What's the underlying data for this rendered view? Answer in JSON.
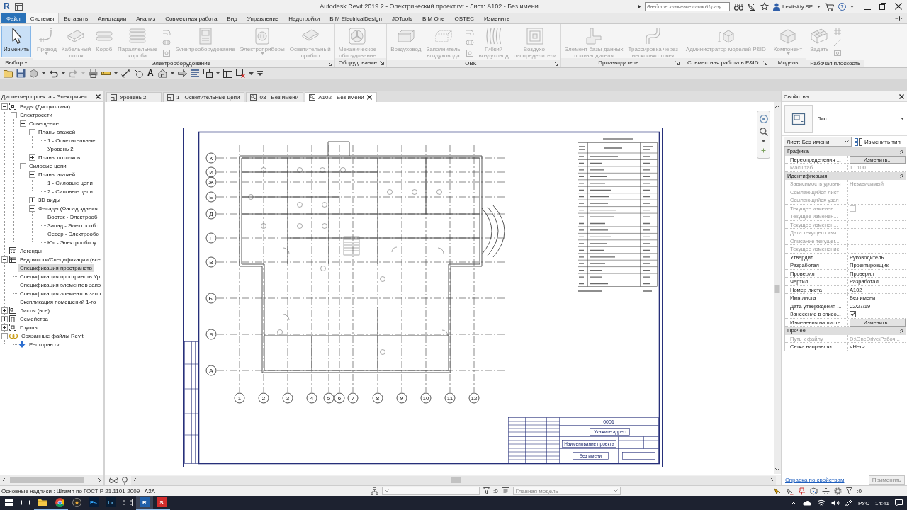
{
  "title_bar": {
    "logo": "R",
    "title": "Autodesk Revit 2019.2 - Электрический проект.rvt - Лист: A102 - Без имени",
    "search": {
      "placeholder": "Введите ключевое слово/фразу"
    },
    "user": "Levitskiy.SP",
    "help": "?"
  },
  "ribbon_tabs": [
    {
      "label": "Файл",
      "kind": "application",
      "selected": false
    },
    {
      "label": "Системы",
      "kind": "tab",
      "selected": true
    },
    {
      "label": "Вставить",
      "kind": "tab",
      "selected": false
    },
    {
      "label": "Аннотации",
      "kind": "tab",
      "selected": false
    },
    {
      "label": "Анализ",
      "kind": "tab",
      "selected": false
    },
    {
      "label": "Совместная работа",
      "kind": "tab",
      "selected": false
    },
    {
      "label": "Вид",
      "kind": "tab",
      "selected": false
    },
    {
      "label": "Управление",
      "kind": "tab",
      "selected": false
    },
    {
      "label": "Надстройки",
      "kind": "tab",
      "selected": false
    },
    {
      "label": "BIM ElectricalDesign",
      "kind": "tab",
      "selected": false
    },
    {
      "label": "JOTools",
      "kind": "tab",
      "selected": false
    },
    {
      "label": "BIM One",
      "kind": "tab",
      "selected": false
    },
    {
      "label": "OSTEC",
      "kind": "tab",
      "selected": false
    },
    {
      "label": "Изменить",
      "kind": "tab",
      "selected": false
    }
  ],
  "ribbon_groups": [
    {
      "label": "Выбор",
      "dropdown": true,
      "launcher": false,
      "buttons": [
        {
          "kind": "large",
          "label": "Изменить",
          "selected": true,
          "disabled": false
        }
      ]
    },
    {
      "label": "Электрооборудование",
      "launcher": true,
      "buttons": [
        {
          "kind": "large",
          "label": "Провод",
          "dropdown": true,
          "selected": false,
          "disabled": true
        },
        {
          "kind": "large",
          "label": "Кабельный\nлоток",
          "selected": false,
          "disabled": true
        },
        {
          "kind": "large",
          "label": "Короб",
          "selected": false,
          "disabled": true
        },
        {
          "kind": "large",
          "label": "Параллельные\nкороба",
          "selected": false,
          "disabled": true
        },
        {
          "kind": "stack",
          "disabled": true
        },
        {
          "kind": "large",
          "label": "Электрооборудование",
          "selected": false,
          "disabled": true
        },
        {
          "kind": "large",
          "label": "Электроприборы",
          "dropdown": true,
          "selected": false,
          "disabled": true
        },
        {
          "kind": "large",
          "label": "Осветительный\nприбор",
          "selected": false,
          "disabled": true
        }
      ]
    },
    {
      "label": "Оборудование",
      "launcher": true,
      "buttons": [
        {
          "kind": "large",
          "label": "Механическое\nоборудование",
          "selected": false,
          "disabled": true
        }
      ]
    },
    {
      "label": "ОВК",
      "launcher": true,
      "buttons": [
        {
          "kind": "large",
          "label": "Воздуховод",
          "selected": false,
          "disabled": true
        },
        {
          "kind": "large",
          "label": "Заполнитель\nвоздуховода",
          "selected": false,
          "disabled": true
        },
        {
          "kind": "stack",
          "disabled": true
        },
        {
          "kind": "large",
          "label": "Гибкий\nвоздуховод",
          "selected": false,
          "disabled": true
        },
        {
          "kind": "large",
          "label": "Воздухо-\nраспределители",
          "selected": false,
          "disabled": true
        }
      ]
    },
    {
      "label": "Производитель",
      "launcher": true,
      "buttons": [
        {
          "kind": "large",
          "label": "Элемент базы данных\nпроизводителя",
          "selected": false,
          "disabled": true
        },
        {
          "kind": "large",
          "label": "Трассировка через\nнесколько точек",
          "selected": false,
          "disabled": true
        }
      ]
    },
    {
      "label": "Совместная работа в P&ID",
      "launcher": true,
      "buttons": [
        {
          "kind": "large",
          "label": "Администратор моделей P&ID",
          "selected": false,
          "disabled": true
        }
      ]
    },
    {
      "label": "Модель",
      "launcher": false,
      "buttons": [
        {
          "kind": "large",
          "label": "Компонент",
          "dropdown": true,
          "selected": false,
          "disabled": true
        }
      ]
    },
    {
      "label": "Рабочая плоскость",
      "launcher": false,
      "buttons": [
        {
          "kind": "large",
          "label": "Задать",
          "selected": false,
          "disabled": true
        },
        {
          "kind": "stack",
          "disabled": true
        }
      ]
    }
  ],
  "quick_access": [
    {
      "kind": "open",
      "disabled": false
    },
    {
      "kind": "save",
      "disabled": false
    },
    {
      "kind": "sync",
      "dropdown": true,
      "disabled": false
    },
    {
      "kind": "undo",
      "dropdown": true,
      "disabled": false
    },
    {
      "kind": "redo",
      "dropdown": true,
      "disabled": true
    },
    {
      "kind": "print",
      "disabled": false
    },
    {
      "kind": "measure",
      "dropdown": true,
      "disabled": false
    },
    {
      "kind": "dimension",
      "disabled": false
    },
    {
      "kind": "tag",
      "disabled": false
    },
    {
      "kind": "text",
      "label": "A",
      "disabled": false
    },
    {
      "kind": "view3d",
      "dropdown": true,
      "disabled": false
    },
    {
      "kind": "section",
      "disabled": false
    },
    {
      "kind": "thinlines",
      "disabled": false
    },
    {
      "kind": "switchwindows",
      "dropdown": true,
      "disabled": false
    },
    {
      "kind": "tilewindows",
      "disabled": false
    },
    {
      "kind": "closewindows",
      "disabled": false
    },
    {
      "kind": "more",
      "disabled": false
    },
    {
      "kind": "customize",
      "disabled": false
    }
  ],
  "project_browser": {
    "title": "Диспетчер проекта - Электричес...",
    "tree": [
      {
        "label": "Виды (Дисциплина)",
        "kind": "views",
        "selected": false,
        "expanded": true,
        "children": [
          {
            "label": "Электросети",
            "selected": false,
            "expanded": true,
            "children": [
              {
                "label": "Освещение",
                "selected": false,
                "expanded": true,
                "children": [
                  {
                    "label": "Планы этажей",
                    "selected": false,
                    "expanded": true,
                    "children": [
                      {
                        "label": "1 - Осветительные",
                        "selected": false
                      },
                      {
                        "label": "Уровень 2",
                        "selected": false
                      }
                    ]
                  },
                  {
                    "label": "Планы потолков",
                    "selected": false,
                    "expanded": false
                  }
                ]
              },
              {
                "label": "Силовые цепи",
                "selected": false,
                "expanded": true,
                "children": [
                  {
                    "label": "Планы этажей",
                    "selected": false,
                    "expanded": true,
                    "children": [
                      {
                        "label": "1 - Силовые цепи",
                        "selected": false
                      },
                      {
                        "label": "2 - Силовые цепи",
                        "selected": false
                      }
                    ]
                  },
                  {
                    "label": "3D виды",
                    "selected": false,
                    "expanded": false
                  },
                  {
                    "label": "Фасады (Фасад здания",
                    "selected": false,
                    "expanded": true,
                    "children": [
                      {
                        "label": "Восток - Электрооб",
                        "selected": false
                      },
                      {
                        "label": "Запад - Электрообо",
                        "selected": false
                      },
                      {
                        "label": "Север - Электрообо",
                        "selected": false
                      },
                      {
                        "label": "Юг - Электрообору",
                        "selected": false
                      }
                    ]
                  }
                ]
              }
            ]
          }
        ]
      },
      {
        "label": "Легенды",
        "kind": "legends",
        "selected": false
      },
      {
        "label": "Ведомости/Спецификации (все",
        "kind": "schedules",
        "selected": false,
        "expanded": true,
        "children": [
          {
            "label": "Спецификация пространств",
            "selected": true
          },
          {
            "label": "Спецификация пространств Ур",
            "selected": false
          },
          {
            "label": "Спецификация элементов запо",
            "selected": false
          },
          {
            "label": "Спецификация элементов запо",
            "selected": false
          },
          {
            "label": "Экспликация помещений 1-го",
            "selected": false
          }
        ]
      },
      {
        "label": "Листы (все)",
        "kind": "sheets",
        "selected": false,
        "expanded": false
      },
      {
        "label": "Семейства",
        "kind": "families",
        "selected": false,
        "expanded": false
      },
      {
        "label": "Группы",
        "kind": "groups",
        "selected": false,
        "expanded": false
      },
      {
        "label": "Связанные файлы Revit",
        "kind": "links",
        "selected": false,
        "expanded": true,
        "children": [
          {
            "label": "Ресторан.rvt",
            "kind": "linkfile",
            "selected": false
          }
        ]
      }
    ]
  },
  "view_tabs": [
    {
      "label": "Уровень 2",
      "kind": "plan",
      "selected": false
    },
    {
      "label": "1 - Осветительные цепи",
      "kind": "plan",
      "selected": false
    },
    {
      "label": "03 - Без имени",
      "kind": "sheet",
      "selected": false
    },
    {
      "label": "A102 - Без имени",
      "kind": "sheet",
      "selected": true
    }
  ],
  "sheet": {
    "grid_rows": [
      "К",
      "И",
      "Ж",
      "Е",
      "Д",
      "Г",
      "В",
      "Б'",
      "Б",
      "А"
    ],
    "grid_columns": [
      "1",
      "2",
      "3",
      "4",
      "5",
      "6",
      "7",
      "8",
      "9",
      "10",
      "11",
      "12"
    ],
    "title_block": {
      "number": "0001",
      "address": "Укажите адрес",
      "project_name": "Наименование проекта",
      "sheet_name": "Без имени"
    }
  },
  "properties": {
    "title": "Свойства",
    "type_name": "Лист",
    "instance": "Лист: Без имени",
    "edit_type": "Изменить тип",
    "groups": [
      {
        "name": "Графика",
        "expanded": true,
        "rows": [
          {
            "name": "Переопределения ...",
            "kind": "button",
            "value": "Изменить...",
            "disabled": false
          },
          {
            "name": "Масштаб",
            "kind": "text",
            "value": "1 : 100",
            "disabled": true
          }
        ]
      },
      {
        "name": "Идентификация",
        "expanded": true,
        "rows": [
          {
            "name": "Зависимость уровня",
            "kind": "text",
            "value": "Независимый",
            "disabled": true
          },
          {
            "name": "Ссылающийся лист",
            "kind": "text",
            "disabled": true
          },
          {
            "name": "Ссылающийся узел",
            "kind": "text",
            "disabled": true
          },
          {
            "name": "Текущее изменен...",
            "kind": "checkbox",
            "checked": false,
            "disabled": true
          },
          {
            "name": "Текущее изменен...",
            "kind": "text",
            "disabled": true
          },
          {
            "name": "Текущее изменен...",
            "kind": "text",
            "disabled": true
          },
          {
            "name": "Дата текущего изм...",
            "kind": "text",
            "disabled": true
          },
          {
            "name": "Описание текущег...",
            "kind": "text",
            "disabled": true
          },
          {
            "name": "Текущее изменение",
            "kind": "text",
            "disabled": true
          },
          {
            "name": "Утвердил",
            "kind": "text",
            "value": "Руководитель",
            "disabled": false
          },
          {
            "name": "Разработал",
            "kind": "text",
            "value": "Проектировщик",
            "disabled": false
          },
          {
            "name": "Проверил",
            "kind": "text",
            "value": "Проверил",
            "disabled": false
          },
          {
            "name": "Чертил",
            "kind": "text",
            "value": "Разработал",
            "disabled": false
          },
          {
            "name": "Номер листа",
            "kind": "text",
            "value": "A102",
            "disabled": false
          },
          {
            "name": "Имя листа",
            "kind": "text",
            "value": "Без имени",
            "disabled": false
          },
          {
            "name": "Дата утверждения ...",
            "kind": "text",
            "value": "02/27/19",
            "disabled": false
          },
          {
            "name": "Занесение в списо...",
            "kind": "checkbox",
            "checked": true,
            "disabled": false
          },
          {
            "name": "Изменения на листе",
            "kind": "button",
            "value": "Изменить...",
            "disabled": false
          }
        ]
      },
      {
        "name": "Прочее",
        "expanded": true,
        "rows": [
          {
            "name": "Путь к файлу",
            "kind": "text",
            "value": "D:\\OneDrive\\Рабоч...",
            "disabled": true
          },
          {
            "name": "Сетка направляю...",
            "kind": "text",
            "value": "<Нет>",
            "disabled": false
          }
        ]
      }
    ],
    "help_link": "Справка по свойствам",
    "apply_button": "Применить"
  },
  "status_bar": {
    "text": "Основные надписи : Штамп по ГОСТ Р 21.1101-2009 : A2A",
    "editable_count": ":0",
    "design_option": "Главная модель",
    "selection_count": ":0"
  },
  "taskbar": {
    "apps": [
      {
        "kind": "explorer",
        "running": true,
        "selected": false
      },
      {
        "kind": "browser",
        "running": true,
        "selected": false
      },
      {
        "kind": "media",
        "running": false,
        "selected": false
      },
      {
        "kind": "photoshop",
        "label": "Ps",
        "running": false,
        "selected": false
      },
      {
        "kind": "lightroom",
        "label": "Lr",
        "running": false,
        "selected": false
      },
      {
        "kind": "video",
        "running": false,
        "selected": false
      },
      {
        "kind": "revit",
        "label": "R",
        "running": true,
        "selected": true
      },
      {
        "kind": "app",
        "label": "S",
        "running": true,
        "selected": false
      }
    ],
    "language": "РУС",
    "time": "14:41"
  }
}
